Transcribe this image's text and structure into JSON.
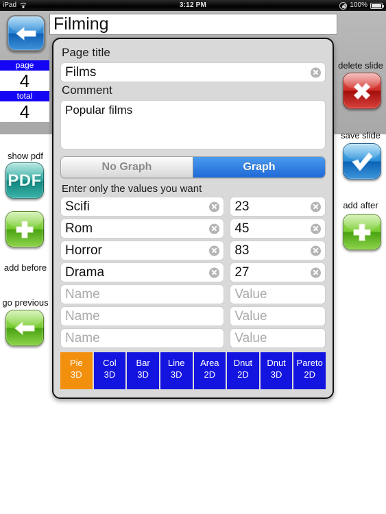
{
  "statusbar": {
    "device": "iPad",
    "wifi_icon": "wifi-icon",
    "time": "3:12 PM",
    "rotation_lock_icon": "rotation-lock-icon",
    "battery_percent": "100%",
    "battery_icon": "battery-icon"
  },
  "header": {
    "document_title": "Filming",
    "back_button_icon": "arrow-left-icon"
  },
  "counters": {
    "page_label": "page",
    "page_value": "4",
    "total_label": "total",
    "total_value": "4"
  },
  "left_sidebar": {
    "show_pdf_label": "show pdf",
    "pdf_button_text": "PDF",
    "add_before_label": "add before",
    "add_before_icon": "plus-icon",
    "go_previous_label": "go previous",
    "go_previous_icon": "arrow-left-icon"
  },
  "right_sidebar": {
    "delete_slide_label": "delete slide",
    "delete_icon": "x-icon",
    "save_slide_label": "save slide",
    "save_icon": "checkmark-icon",
    "add_after_label": "add after",
    "add_after_icon": "plus-icon"
  },
  "panel": {
    "page_title_label": "Page title",
    "page_title_value": "Films",
    "comment_label": "Comment",
    "comment_value": "Popular films",
    "segmented": {
      "no_graph_label": "No Graph",
      "graph_label": "Graph",
      "selected": "Graph"
    },
    "rows_title": "Enter only the values you want",
    "name_placeholder": "Name",
    "value_placeholder": "Value",
    "rows": [
      {
        "name": "Scifi",
        "value": "23"
      },
      {
        "name": "Rom",
        "value": "45"
      },
      {
        "name": "Horror",
        "value": "83"
      },
      {
        "name": "Drama",
        "value": "27"
      },
      {
        "name": "",
        "value": ""
      },
      {
        "name": "",
        "value": ""
      },
      {
        "name": "",
        "value": ""
      }
    ],
    "chart_types": [
      {
        "line1": "Pie",
        "line2": "3D",
        "selected": true
      },
      {
        "line1": "Col",
        "line2": "3D",
        "selected": false
      },
      {
        "line1": "Bar",
        "line2": "3D",
        "selected": false
      },
      {
        "line1": "Line",
        "line2": "3D",
        "selected": false
      },
      {
        "line1": "Area",
        "line2": "2D",
        "selected": false
      },
      {
        "line1": "Dnut",
        "line2": "2D",
        "selected": false
      },
      {
        "line1": "Dnut",
        "line2": "3D",
        "selected": false
      },
      {
        "line1": "Pareto",
        "line2": "2D",
        "selected": false
      }
    ]
  },
  "colors": {
    "accent_blue": "#1405f5",
    "selected_orange": "#f2900d",
    "chart_button_blue": "#1414e0",
    "segment_blue": "#2f7fe0"
  },
  "chart_data": {
    "type": "pie",
    "title": "Films",
    "categories": [
      "Scifi",
      "Rom",
      "Horror",
      "Drama"
    ],
    "values": [
      23,
      45,
      83,
      27
    ],
    "style": "Pie 3D"
  }
}
